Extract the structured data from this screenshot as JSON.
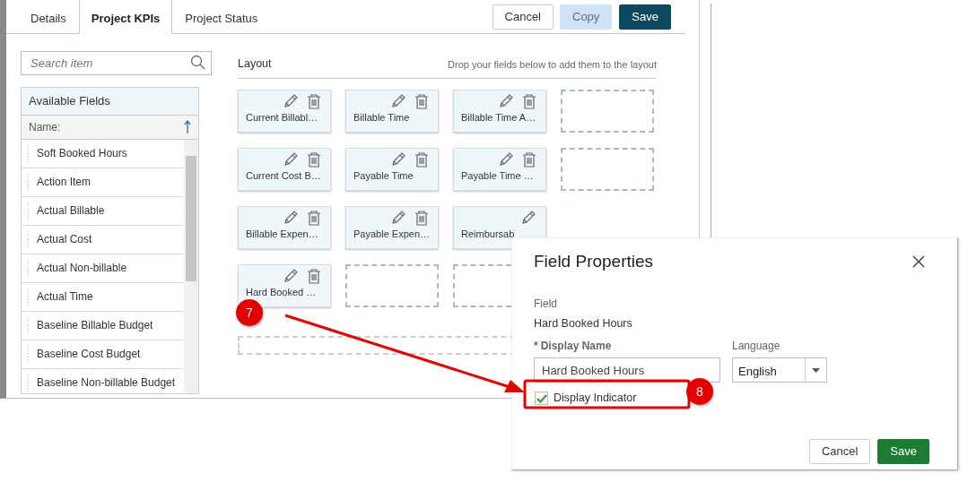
{
  "tabs": [
    {
      "label": "Details",
      "selected": false
    },
    {
      "label": "Project KPIs",
      "selected": true
    },
    {
      "label": "Project Status",
      "selected": false
    }
  ],
  "toolbar_buttons": [
    {
      "label": "Cancel",
      "kind": "outline"
    },
    {
      "label": "Copy",
      "kind": "light"
    },
    {
      "label": "Save",
      "kind": "dark"
    }
  ],
  "search": {
    "placeholder": "Search item"
  },
  "available_fields": {
    "title": "Available Fields",
    "sort_label": "Name:",
    "items": [
      "Soft Booked Hours",
      "Action Item",
      "Actual Billable",
      "Actual Cost",
      "Actual Non-billable",
      "Actual Time",
      "Baseline Billable Budget",
      "Baseline Cost Budget",
      "Baseline Non-billable Budget"
    ]
  },
  "layout": {
    "title": "Layout",
    "hint": "Drop your fields below to add them to the layout",
    "rows": [
      [
        {
          "kind": "field",
          "label": "Current Billabl…"
        },
        {
          "kind": "field",
          "label": "Billable Time"
        },
        {
          "kind": "field",
          "label": "Billable Time A…"
        },
        {
          "kind": "empty"
        }
      ],
      [
        {
          "kind": "field",
          "label": "Current Cost B…"
        },
        {
          "kind": "field",
          "label": "Payable Time"
        },
        {
          "kind": "field",
          "label": "Payable Time …"
        },
        {
          "kind": "empty"
        }
      ],
      [
        {
          "kind": "field",
          "label": "Billable Expen…"
        },
        {
          "kind": "field",
          "label": "Payable Expen…"
        },
        {
          "kind": "partial",
          "label": "Reimbursab"
        }
      ],
      [
        {
          "kind": "field",
          "label": "Hard Booked …"
        },
        {
          "kind": "empty"
        },
        {
          "kind": "empty"
        }
      ]
    ]
  },
  "dialog": {
    "title": "Field Properties",
    "field_label": "Field",
    "field_value": "Hard Booked Hours",
    "display_name_required_mark": "*",
    "display_name_label": "Display Name",
    "display_name_value": "Hard Booked Hours",
    "language_label": "Language",
    "language_value": "English",
    "indicator_label": "Display Indicator",
    "indicator_checked": true,
    "buttons": [
      {
        "label": "Cancel",
        "kind": "outline"
      },
      {
        "label": "Save",
        "kind": "success"
      }
    ]
  },
  "callouts": [
    {
      "number": "7"
    },
    {
      "number": "8"
    }
  ]
}
